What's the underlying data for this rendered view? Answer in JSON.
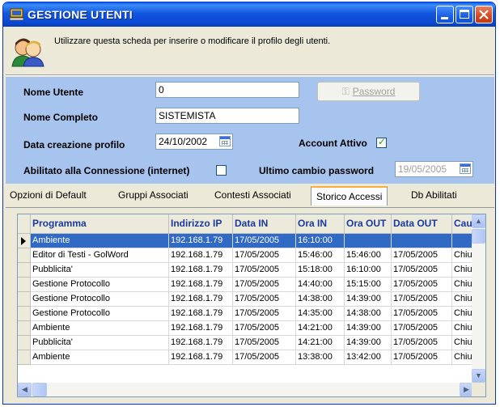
{
  "window": {
    "title": "GESTIONE UTENTI",
    "icon": "app-computer-icon",
    "controls": [
      "minimize-icon",
      "maximize-icon",
      "close-icon"
    ]
  },
  "info": {
    "text": "Utilizzare questa scheda per inserire o modificare il profilo degli utenti.",
    "icon": "users-icon"
  },
  "form": {
    "nome_utente_label": "Nome Utente",
    "nome_utente_value": "0",
    "nome_completo_label": "Nome Completo",
    "nome_completo_value": "SISTEMISTA",
    "data_creazione_label": "Data creazione profilo",
    "data_creazione_value": "24/10/2002",
    "account_attivo_label": "Account Attivo",
    "account_attivo_checked": true,
    "abilitato_label": "Abilitato alla Connessione (internet)",
    "abilitato_checked": false,
    "ultimo_cambio_label": "Ultimo cambio password",
    "ultimo_cambio_value": "19/05/2005",
    "password_button_label": "Password"
  },
  "tabs": [
    {
      "label": "Opzioni di Default",
      "active": false
    },
    {
      "label": "Gruppi Associati",
      "active": false
    },
    {
      "label": "Contesti Associati",
      "active": false
    },
    {
      "label": "Storico Accessi",
      "active": true
    },
    {
      "label": "Db Abilitati",
      "active": false
    }
  ],
  "grid": {
    "columns": [
      "Programma",
      "Indirizzo IP",
      "Data IN",
      "Ora IN",
      "Ora OUT",
      "Data OUT",
      "Cau"
    ],
    "rows": [
      [
        "Ambiente",
        "192.168.1.79",
        "17/05/2005",
        "16:10:00",
        "",
        "",
        ""
      ],
      [
        "Editor di Testi - GolWord",
        "192.168.1.79",
        "17/05/2005",
        "15:46:00",
        "15:46:00",
        "17/05/2005",
        "Chiu"
      ],
      [
        "Pubblicita'",
        "192.168.1.79",
        "17/05/2005",
        "15:18:00",
        "16:10:00",
        "17/05/2005",
        "Chiu"
      ],
      [
        "Gestione Protocollo",
        "192.168.1.79",
        "17/05/2005",
        "14:40:00",
        "15:15:00",
        "17/05/2005",
        "Chiu"
      ],
      [
        "Gestione Protocollo",
        "192.168.1.79",
        "17/05/2005",
        "14:38:00",
        "14:39:00",
        "17/05/2005",
        "Chiu"
      ],
      [
        "Gestione Protocollo",
        "192.168.1.79",
        "17/05/2005",
        "14:35:00",
        "14:38:00",
        "17/05/2005",
        "Chiu"
      ],
      [
        "Ambiente",
        "192.168.1.79",
        "17/05/2005",
        "14:21:00",
        "14:39:00",
        "17/05/2005",
        "Chiu"
      ],
      [
        "Pubblicita'",
        "192.168.1.79",
        "17/05/2005",
        "14:21:00",
        "14:39:00",
        "17/05/2005",
        "Chiu"
      ],
      [
        "Ambiente",
        "192.168.1.79",
        "17/05/2005",
        "13:38:00",
        "13:42:00",
        "17/05/2005",
        "Chiu"
      ]
    ],
    "selected_row": 0
  },
  "colors": {
    "titlebar": "#0a47d0",
    "form_background": "#a6c4ee",
    "selection": "#316ac5",
    "header_text": "#1a3aa0",
    "active_tab_accent": "#f8b23c"
  }
}
